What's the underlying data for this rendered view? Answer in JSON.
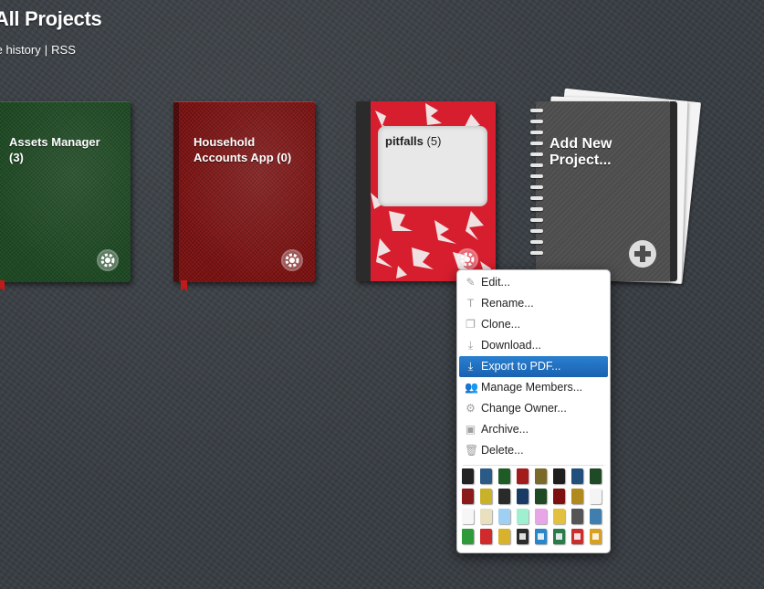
{
  "header": {
    "title": "All Projects",
    "link_history": "te history",
    "separator": "|",
    "link_rss": "RSS"
  },
  "projects": [
    {
      "name": "Assets Manager",
      "count": "(3)",
      "cover": "green-leather"
    },
    {
      "name": "Household Accounts App",
      "count": "(0)",
      "cover": "red-leather"
    },
    {
      "name": "pitfalls",
      "count": "(5)",
      "cover": "red-composition"
    }
  ],
  "add_project": {
    "label": "Add New Project..."
  },
  "context_menu": {
    "items": [
      {
        "label": "Edit...",
        "icon": "pencil-icon",
        "glyph": "✎"
      },
      {
        "label": "Rename...",
        "icon": "text-icon",
        "glyph": "T"
      },
      {
        "label": "Clone...",
        "icon": "copy-icon",
        "glyph": "❐"
      },
      {
        "label": "Download...",
        "icon": "download-icon",
        "glyph": "⤓"
      },
      {
        "label": "Export to PDF...",
        "icon": "export-icon",
        "glyph": "⤓",
        "selected": true
      },
      {
        "label": "Manage Members...",
        "icon": "members-icon",
        "glyph": "👥"
      },
      {
        "label": "Change Owner...",
        "icon": "gear-icon",
        "glyph": "⚙"
      },
      {
        "label": "Archive...",
        "icon": "archive-icon",
        "glyph": "▣"
      },
      {
        "label": "Delete...",
        "icon": "trash-icon",
        "glyph": "🗑"
      }
    ],
    "selected_color": "#1a62b0",
    "cover_swatches": [
      [
        "#222222",
        "#2a5a86",
        "#1f5b24",
        "#a31b1b",
        "#7a6a2a",
        "#1e1e1e",
        "#1f4f7a",
        "#1f4a26"
      ],
      [
        "#8b1a1a",
        "#c9b12a",
        "#2a2a2a",
        "#1a3a66",
        "#1e4a23",
        "#7d1111",
        "#b08a1e",
        "#f4f4f4"
      ],
      [
        "#f6f6f6",
        "#e9e0c0",
        "#9fd0f4",
        "#9ff0d0",
        "#e8a6e8",
        "#e2c040",
        "#555555",
        "#3f7fb0"
      ],
      [
        "#2e9a3a",
        "#d02a2a",
        "#d8b22a",
        "#2b2b2b",
        "#2a86c8",
        "#2a7a4a",
        "#c83030",
        "#d8a020"
      ]
    ]
  }
}
